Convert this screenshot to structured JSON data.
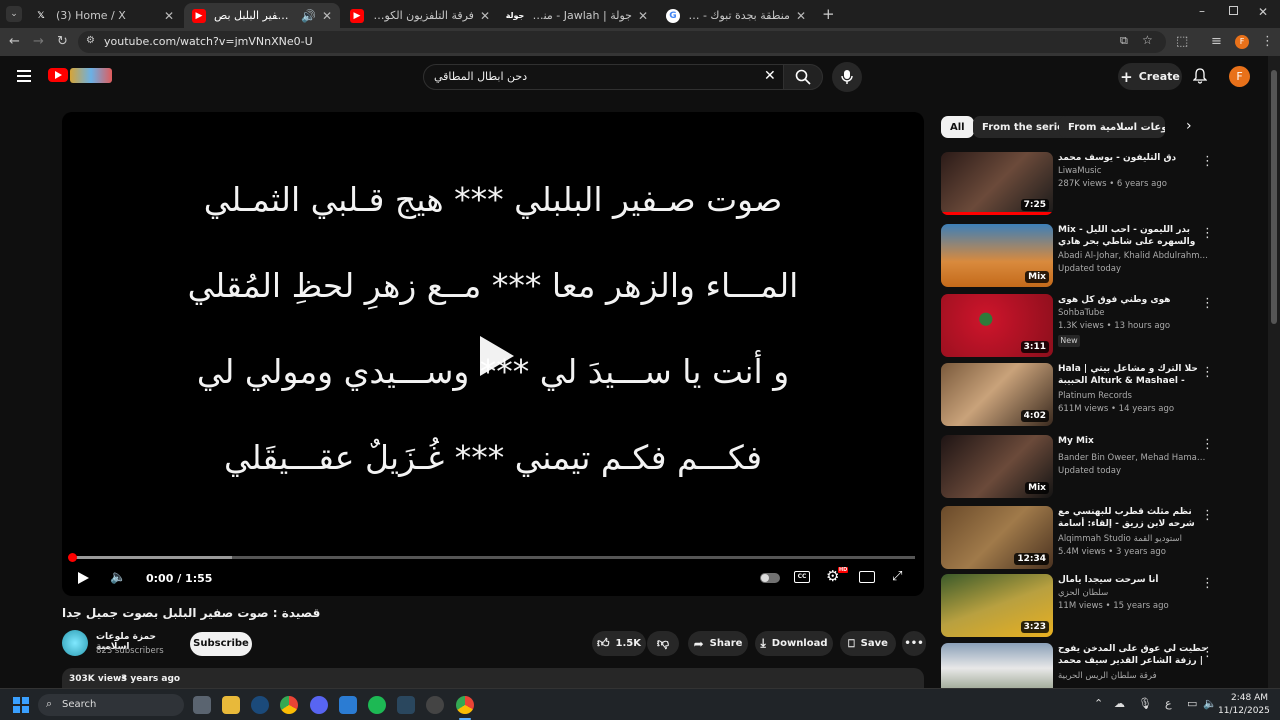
{
  "browser": {
    "tabs": [
      {
        "title": "(3) Home / X",
        "favicon": "x-logo-icon"
      },
      {
        "title": "قصيدة : صوت صفير البلبل بص",
        "favicon": "youtube-icon",
        "active": true
      },
      {
        "title": "فرقة التلفزيون الكويتية / فز الخفق",
        "favicon": "youtube-icon"
      },
      {
        "title": "جولة | Jawlah - منصة الألعاب الت",
        "favicon": "jawlah-icon"
      },
      {
        "title": "منطقة بجدة تبوك - Google Search",
        "favicon": "google-icon"
      }
    ],
    "url": "youtube.com/watch?v=jmVNnXNe0-U",
    "profile_letter": "F"
  },
  "youtube": {
    "search_query": "دحن ابطال المطاقي",
    "create_label": "Create",
    "avatar_letter": "F"
  },
  "player": {
    "lyrics": [
      "صوت صـفير البلبلي *** هيج قـلبي الثمـلي",
      "المـــاء والزهر معا *** مــع زهرِ لحظِ المُقلي",
      "و أنت يا ســـيدَ لي *** وســـيدي ومولي لي",
      "فكـــم فكـم تيمني *** غُـزَيلٌ عقـــيقَلي"
    ],
    "time": "0:00 / 1:55",
    "hd_badge": "HD",
    "progress_buffered": 0.19
  },
  "video": {
    "title": "قصيدة : صوت صفير البلبل بصوت جميل جدا",
    "channel": "حمزة ملوعات اسلامية",
    "subscribers": "823 subscribers",
    "subscribe_label": "Subscribe",
    "likes": "1.5K",
    "share_label": "Share",
    "download_label": "Download",
    "save_label": "Save",
    "views": "303K views",
    "age": "3 years ago"
  },
  "sidebar": {
    "chips": [
      "All",
      "From the series",
      "From حمزة ملوعات اسلامية"
    ],
    "items": [
      {
        "title": "دق التليفون - يوسف محمد",
        "channel": "LiwaMusic",
        "meta": "287K views • 6 years ago",
        "duration": "7:25"
      },
      {
        "title": "Mix - بدر الليمون - احب الليل والسهره على شاطي بحر هادي",
        "channel": "Abadi Al-Johar, Khalid Abdulrahman, Bad...",
        "meta": "Updated today",
        "duration": "Mix"
      },
      {
        "title": "هوى وطني فوق كل هوى",
        "channel": "SohbaTube",
        "meta": "1.3K views • 13 hours ago",
        "duration": "3:11",
        "badge": "New"
      },
      {
        "title": "Hala | حلا الترك و مشاعل بيتي الحبيبة Alturk & Mashael - Bnayty ...",
        "channel": "Platinum Records",
        "meta": "611M views • 14 years ago",
        "duration": "4:02"
      },
      {
        "title": "My Mix",
        "channel": "Bander Bin Oweer, Mehad Hamad, and m...",
        "meta": "Updated today",
        "duration": "Mix"
      },
      {
        "title": "نظم مثلث قطرب للبهنسي مع شرحه لابن زريق - إلقاء: أسامة الواعظ",
        "channel": "Alqimmah Studio استوديو القمة",
        "meta": "5.4M views • 3 years ago",
        "duration": "12:34"
      },
      {
        "title": "أنا سرحت سيجدا يامال",
        "channel": "سلطان الحزي",
        "meta": "11M views • 15 years ago",
        "duration": "3:23"
      },
      {
        "title": "حطيت لي عوق على المدخن يفوح | رزفة الشاعر القدير سيف محمد الكعبي اليونايف",
        "channel": "فرقة سلطان الريس الحربية",
        "meta": "",
        "duration": ""
      }
    ]
  },
  "taskbar": {
    "search_label": "Search",
    "time": "2:48 AM",
    "date": "11/12/2025",
    "lang": "ع"
  },
  "colors": {
    "accent_red": "#ff0000",
    "avatar_orange": "#e8711a",
    "bg": "#0f0f0f"
  }
}
